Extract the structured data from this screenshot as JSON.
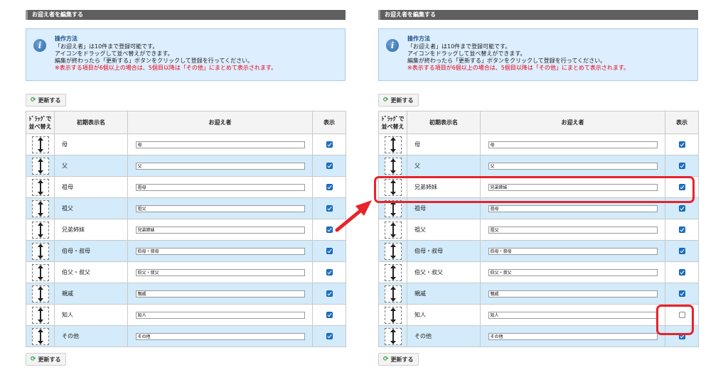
{
  "colors": {
    "header_bg": "#5f5f5f",
    "info_bg": "#ddeeff",
    "row_alt": "#d3ebfa",
    "checkbox": "#1e73c8",
    "highlight": "#e8232a",
    "warning": "#e60012"
  },
  "panel_title": "お迎え者を編集する",
  "info": {
    "icon": "info-icon",
    "title": "操作方法",
    "lines": [
      "「お迎え者」は10件まで登録可能です。",
      "アイコンをドラッグして並べ替えができます。",
      "編集が終わったら「更新する」ボタンをクリックして登録を行ってください。"
    ],
    "warning": "※表示する項目が6個以上の場合は、5個目以降は「その他」にまとめて表示されます。"
  },
  "update_button": {
    "label": "更新する",
    "icon": "refresh-icon"
  },
  "columns": {
    "drag_l1": "ﾄﾞﾗｯｸﾞで",
    "drag_l2": "並べ替え",
    "default_name": "初期表示名",
    "pickup": "お迎え者",
    "display": "表示"
  },
  "before_rows": [
    {
      "name": "母",
      "value": "母",
      "checked": true
    },
    {
      "name": "父",
      "value": "父",
      "checked": true
    },
    {
      "name": "祖母",
      "value": "祖母",
      "checked": true
    },
    {
      "name": "祖父",
      "value": "祖父",
      "checked": true
    },
    {
      "name": "兄弟姉妹",
      "value": "兄弟姉妹",
      "checked": true
    },
    {
      "name": "伯母・叔母",
      "value": "伯母・叔母",
      "checked": true
    },
    {
      "name": "伯父・叔父",
      "value": "伯父・叔父",
      "checked": true
    },
    {
      "name": "親戚",
      "value": "親戚",
      "checked": true
    },
    {
      "name": "知人",
      "value": "知人",
      "checked": true
    },
    {
      "name": "その他",
      "value": "その他",
      "checked": true
    }
  ],
  "after_rows": [
    {
      "name": "母",
      "value": "母",
      "checked": true
    },
    {
      "name": "父",
      "value": "父",
      "checked": true
    },
    {
      "name": "兄弟姉妹",
      "value": "兄弟姉妹",
      "checked": true
    },
    {
      "name": "祖母",
      "value": "祖母",
      "checked": true
    },
    {
      "name": "祖父",
      "value": "祖父",
      "checked": true
    },
    {
      "name": "伯母・叔母",
      "value": "伯母・叔母",
      "checked": true
    },
    {
      "name": "伯父・叔父",
      "value": "伯父・叔父",
      "checked": true
    },
    {
      "name": "親戚",
      "value": "親戚",
      "checked": true
    },
    {
      "name": "知人",
      "value": "知人",
      "checked": false
    },
    {
      "name": "その他",
      "value": "その他",
      "checked": true
    }
  ]
}
